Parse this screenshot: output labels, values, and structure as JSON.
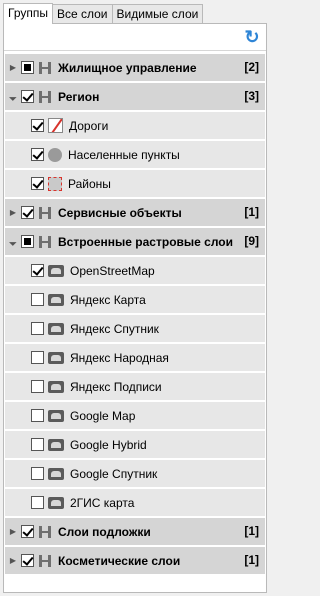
{
  "tabs": [
    {
      "label": "Группы",
      "active": true
    },
    {
      "label": "Все слои",
      "active": false
    },
    {
      "label": "Видимые слои",
      "active": false
    }
  ],
  "toolbar": {
    "refresh_icon": "refresh-icon"
  },
  "groups": [
    {
      "label": "Жилищное управление",
      "count": "[2]",
      "expanded": false,
      "state": "partial"
    },
    {
      "label": "Регион",
      "count": "[3]",
      "expanded": true,
      "state": "checked",
      "children": [
        {
          "label": "Дороги",
          "icon": "line-icon",
          "checked": true
        },
        {
          "label": "Населенные пункты",
          "icon": "point-icon",
          "checked": true
        },
        {
          "label": "Районы",
          "icon": "polygon-icon",
          "checked": true
        }
      ]
    },
    {
      "label": "Сервисные объекты",
      "count": "[1]",
      "expanded": false,
      "state": "checked"
    },
    {
      "label": "Встроенные растровые слои",
      "count": "[9]",
      "expanded": true,
      "state": "partial",
      "children": [
        {
          "label": "OpenStreetMap",
          "icon": "raster-icon",
          "checked": true
        },
        {
          "label": "Яндекс Карта",
          "icon": "raster-icon",
          "checked": false
        },
        {
          "label": "Яндекс Спутник",
          "icon": "raster-icon",
          "checked": false
        },
        {
          "label": "Яндекс Народная",
          "icon": "raster-icon",
          "checked": false
        },
        {
          "label": "Яндекс Подписи",
          "icon": "raster-icon",
          "checked": false
        },
        {
          "label": "Google Map",
          "icon": "raster-icon",
          "checked": false
        },
        {
          "label": "Google Hybrid",
          "icon": "raster-icon",
          "checked": false
        },
        {
          "label": "Google Спутник",
          "icon": "raster-icon",
          "checked": false
        },
        {
          "label": "2ГИС карта",
          "icon": "raster-icon",
          "checked": false
        }
      ]
    },
    {
      "label": "Слои подложки",
      "count": "[1]",
      "expanded": false,
      "state": "checked"
    },
    {
      "label": "Косметические слои",
      "count": "[1]",
      "expanded": false,
      "state": "checked"
    }
  ]
}
